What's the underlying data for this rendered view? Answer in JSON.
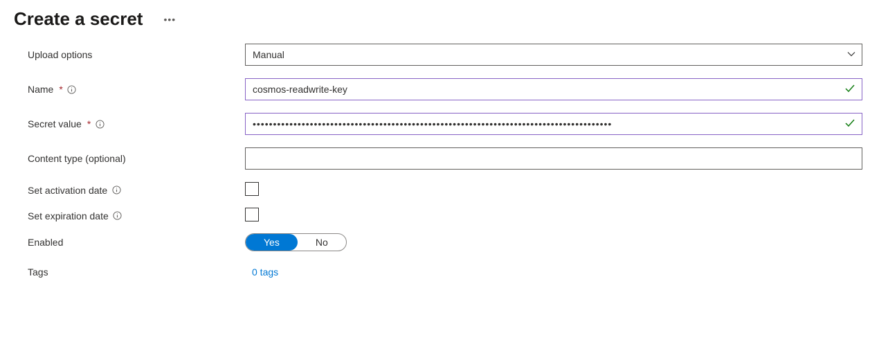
{
  "header": {
    "title": "Create a secret",
    "more_icon": "ellipsis-icon"
  },
  "form": {
    "upload_options": {
      "label": "Upload options",
      "value": "Manual"
    },
    "name": {
      "label": "Name",
      "value": "cosmos-readwrite-key"
    },
    "secret_value": {
      "label": "Secret value",
      "value": "••••••••••••••••••••••••••••••••••••••••••••••••••••••••••••••••••••••••••••••••••••••••"
    },
    "content_type": {
      "label": "Content type (optional)",
      "value": ""
    },
    "activation": {
      "label": "Set activation date"
    },
    "expiration": {
      "label": "Set expiration date"
    },
    "enabled": {
      "label": "Enabled",
      "yes": "Yes",
      "no": "No"
    },
    "tags": {
      "label": "Tags",
      "link": "0 tags"
    }
  }
}
